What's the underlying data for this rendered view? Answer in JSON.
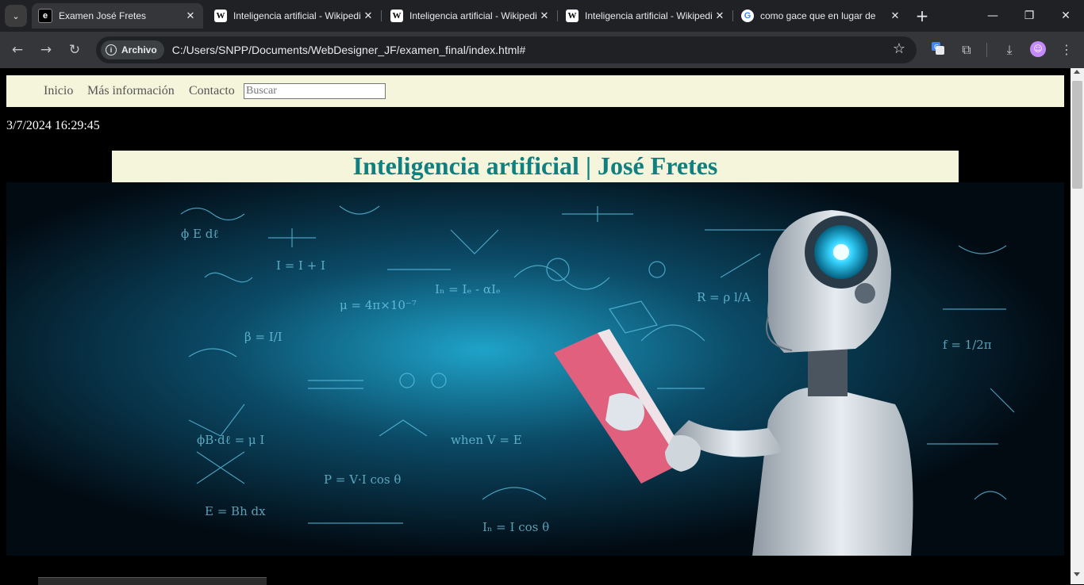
{
  "browser": {
    "tabs": [
      {
        "title": "Examen José Fretes",
        "favicon": "page-favicon",
        "active": true
      },
      {
        "title": "Inteligencia artificial - Wikipedia",
        "favicon": "wikipedia-favicon"
      },
      {
        "title": "Inteligencia artificial - Wikipedia",
        "favicon": "wikipedia-favicon"
      },
      {
        "title": "Inteligencia artificial - Wikipedia",
        "favicon": "wikipedia-favicon"
      },
      {
        "title": "como gace que en lugar de",
        "favicon": "google-favicon"
      }
    ],
    "chip_label": "Archivo",
    "url": "C:/Users/SNPP/Documents/WebDesigner_JF/examen_final/index.html#"
  },
  "page": {
    "nav": [
      {
        "label": "Inicio"
      },
      {
        "label": "Más información"
      },
      {
        "label": "Contacto"
      }
    ],
    "search_placeholder": "Buscar",
    "datetime": "3/7/2024 16:29:45",
    "title": "Inteligencia artificial | José Fretes",
    "hero_image": "robot-reading-book-image",
    "colors": {
      "nav_bg": "#f5f5dc",
      "title_color": "#0f7f7f",
      "page_bg": "#000000"
    }
  }
}
